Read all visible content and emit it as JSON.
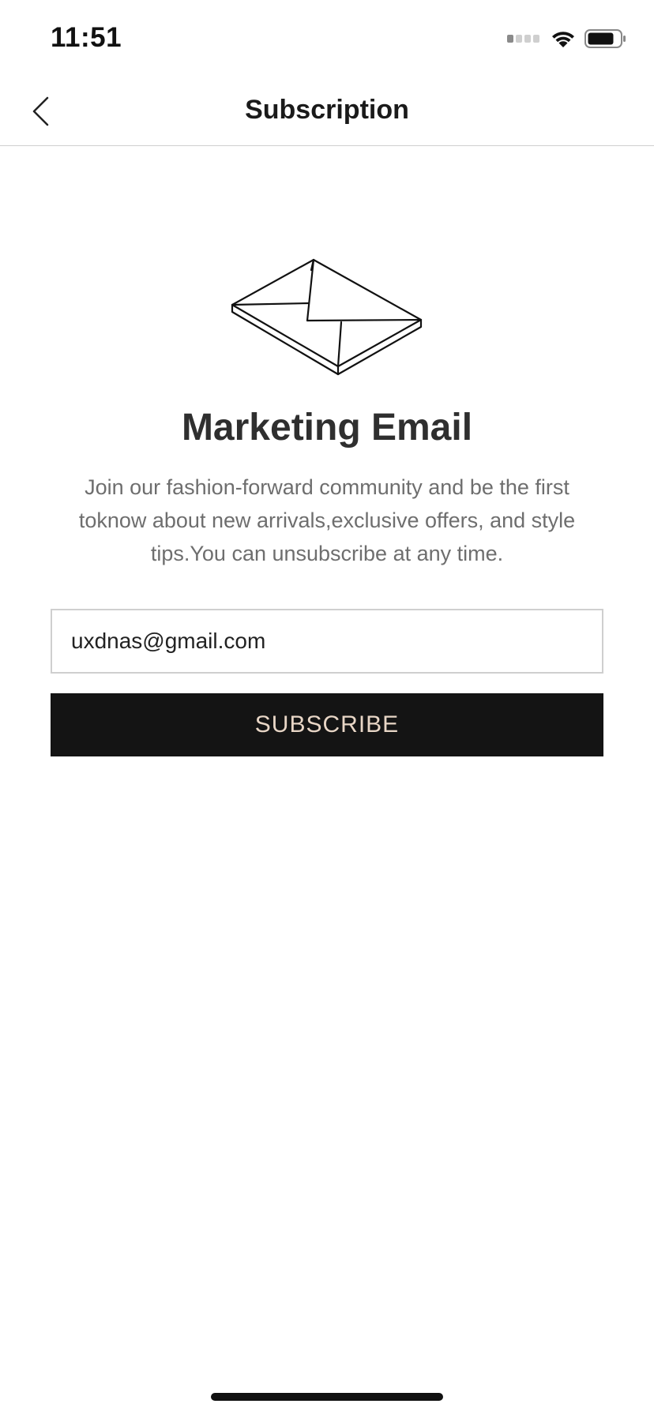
{
  "status_bar": {
    "time": "11:51",
    "icons": [
      "cellular-signal-icon",
      "wifi-icon",
      "battery-icon"
    ]
  },
  "nav": {
    "back_icon": "chevron-left-icon",
    "title": "Subscription"
  },
  "main": {
    "hero_icon": "envelope-icon",
    "headline": "Marketing Email",
    "description": "Join our fashion-forward community and be the first toknow about new arrivals,exclusive offers, and style tips.You can unsubscribe at any time.",
    "email_value": "uxdnas@gmail.com",
    "subscribe_label": "SUBSCRIBE"
  },
  "colors": {
    "button_background": "#141414",
    "button_text": "#e8d6c6",
    "divider": "#cfcfcf"
  }
}
